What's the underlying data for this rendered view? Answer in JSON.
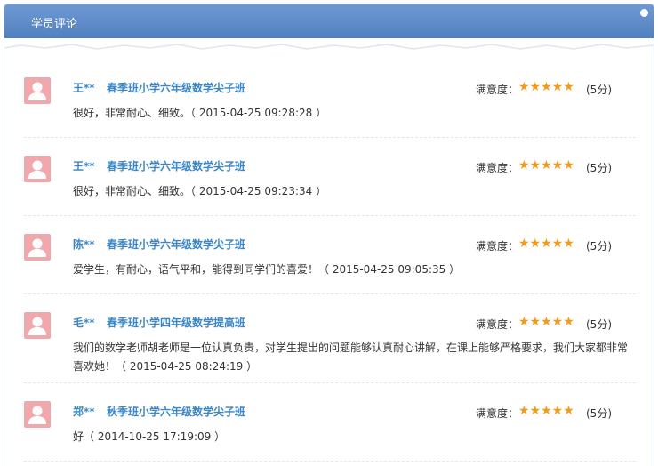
{
  "panel": {
    "title": "学员评论"
  },
  "rating_label": "满意度：",
  "stars": "★★★★★",
  "reviews": [
    {
      "name": "王**",
      "course": "春季班小学六年级数学尖子班",
      "score": "(5分)",
      "comment": "很好，非常耐心、细致。（ 2015-04-25 09:28:28 ）"
    },
    {
      "name": "王**",
      "course": "春季班小学六年级数学尖子班",
      "score": "(5分)",
      "comment": "很好，非常耐心、细致。（ 2015-04-25 09:23:34 ）"
    },
    {
      "name": "陈**",
      "course": "春季班小学六年级数学尖子班",
      "score": "(5分)",
      "comment": "爱学生，有耐心，语气平和，能得到同学们的喜爱！（ 2015-04-25 09:05:35 ）"
    },
    {
      "name": "毛**",
      "course": "春季班小学四年级数学提高班",
      "score": "(5分)",
      "comment": "我们的数学老师胡老师是一位认真负责，对学生提出的问题能够认真耐心讲解，在课上能够严格要求，我们大家都非常喜欢她！（ 2015-04-25 08:24:19 ）"
    },
    {
      "name": "郑**",
      "course": "秋季班小学六年级数学尖子班",
      "score": "(5分)",
      "comment": "好（ 2014-10-25 17:19:09 ）"
    }
  ]
}
